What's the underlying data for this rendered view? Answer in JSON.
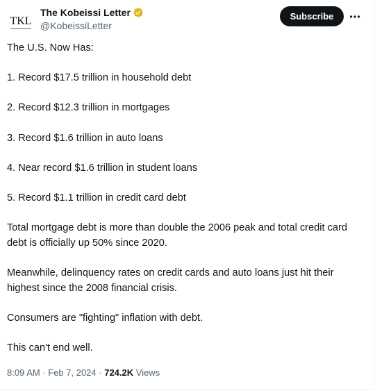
{
  "author": {
    "avatar_text": "TKL",
    "display_name": "The Kobeissi Letter",
    "handle": "@KobeissiLetter",
    "verified_badge_color": "#e2b719"
  },
  "header": {
    "subscribe_label": "Subscribe",
    "more_icon": "ellipsis-icon"
  },
  "tweet": {
    "paragraphs": [
      "The U.S. Now Has:",
      "1. Record $17.5 trillion in household debt",
      "2. Record $12.3 trillion in mortgages",
      "3. Record $1.6 trillion in auto loans",
      "4. Near record $1.6 trillion in student loans",
      "5. Record $1.1 trillion in credit card debt",
      "Total mortgage debt is more than double the 2006 peak and total credit card debt is officially up 50% since 2020.",
      "Meanwhile, delinquency rates on credit cards and auto loans just hit their highest since the 2008 financial crisis.",
      "Consumers are \"fighting\" inflation with debt.",
      "This can't end well."
    ]
  },
  "meta": {
    "time": "8:09 AM",
    "separator": " · ",
    "date": "Feb 7, 2024",
    "views_count": "724.2K",
    "views_label": " Views"
  },
  "colors": {
    "text": "#0f1419",
    "secondary": "#536471",
    "button_bg": "#0f1419",
    "border": "#eff3f4"
  }
}
